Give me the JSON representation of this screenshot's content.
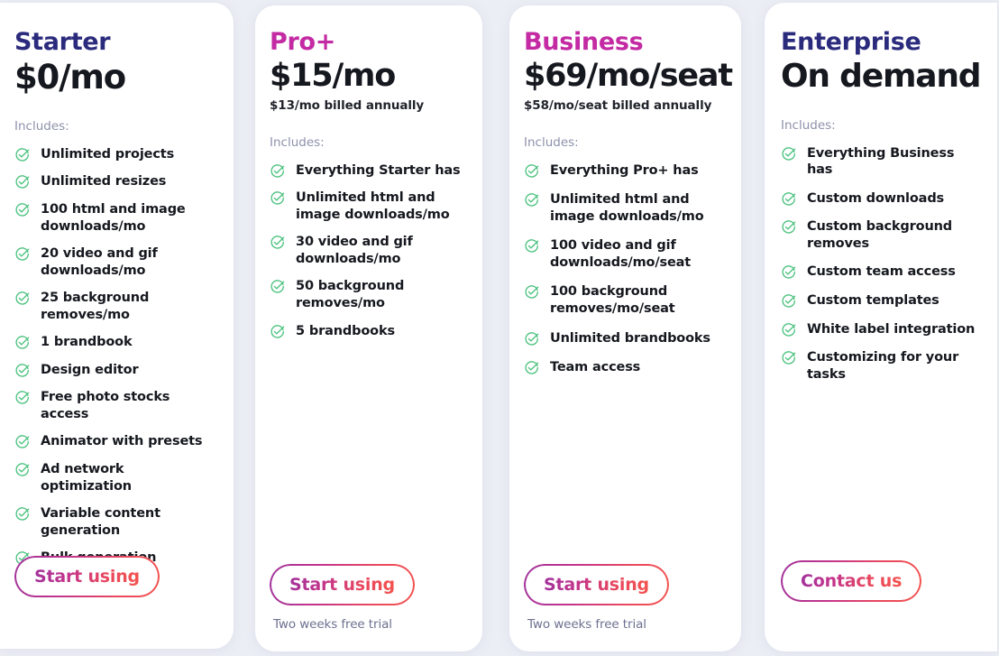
{
  "page": {
    "background_color": "#eceef5",
    "check_icon_color": "#4cc27f",
    "cta_gradient_from": "#a1329b",
    "cta_gradient_to": "#f4534e",
    "includes_label": "Includes:"
  },
  "plans": [
    {
      "name": "Starter",
      "name_color": "#2b2b7d",
      "price": "$0/mo",
      "subprice": "",
      "includes_label": "Includes:",
      "features": [
        "Unlimited projects",
        "Unlimited resizes",
        "100 html and image downloads/mo",
        "20 video and gif downloads/mo",
        "25 background removes/mo",
        "1 brandbook",
        "Design editor",
        "Free photo stocks access",
        "Animator with presets",
        "Ad network optimization",
        "Variable content generation",
        "Bulk generation"
      ],
      "cta_label": "Start using",
      "trial_note": ""
    },
    {
      "name": "Pro+",
      "name_color": "#c32aa3",
      "price": "$15/mo",
      "subprice": "$13/mo billed annually",
      "includes_label": "Includes:",
      "features": [
        "Everything Starter has",
        "Unlimited html and image downloads/mo",
        "30 video and gif downloads/mo",
        "50 background removes/mo",
        "5 brandbooks"
      ],
      "cta_label": "Start using",
      "trial_note": "Two weeks free trial"
    },
    {
      "name": "Business",
      "name_color": "#c32aa3",
      "price": "$69/mo/seat",
      "subprice": "$58/mo/seat billed annually",
      "includes_label": "Includes:",
      "features": [
        "Everything Pro+ has",
        "Unlimited html and image downloads/mo",
        "100 video and gif downloads/mo/seat",
        "100 background removes/mo/seat",
        "Unlimited brandbooks",
        "Team access"
      ],
      "cta_label": "Start using",
      "trial_note": "Two weeks free trial"
    },
    {
      "name": "Enterprise",
      "name_color": "#2b2b7d",
      "price": "On demand",
      "subprice": "",
      "includes_label": "Includes:",
      "features": [
        "Everything Business has",
        "Custom downloads",
        "Custom background removes",
        "Custom team access",
        "Custom templates",
        "White label integration",
        "Customizing for your tasks"
      ],
      "cta_label": "Contact us",
      "trial_note": ""
    }
  ]
}
